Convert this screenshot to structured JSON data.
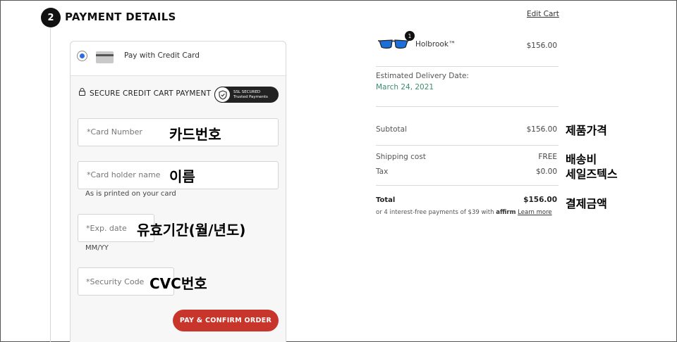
{
  "step": {
    "number": "2",
    "title": "PAYMENT DETAILS"
  },
  "payment": {
    "method_label": "Pay with Credit Card",
    "secure_label": "SECURE CREDIT CART PAYMENT",
    "ssl_line1": "SSL SECURED",
    "ssl_line2": "Trusted Payments",
    "card_number_placeholder": "*Card Number",
    "card_number_annotation": "카드번호",
    "holder_placeholder": "*Card holder name",
    "holder_annotation": "이름",
    "holder_hint": "As is printed on your card",
    "exp_placeholder": "*Exp. date",
    "exp_annotation": "유효기간(월/년도)",
    "exp_hint": "MM/YY",
    "cvc_placeholder": "*Security Code",
    "cvc_annotation": "CVC번호",
    "pay_button": "PAY & CONFIRM ORDER"
  },
  "summary": {
    "edit_cart": "Edit Cart",
    "product": {
      "name": "Holbrook™",
      "qty": "1",
      "price": "$156.00"
    },
    "delivery_label": "Estimated Delivery Date:",
    "delivery_date": "March 24, 2021",
    "subtotal_label": "Subtotal",
    "subtotal_value": "$156.00",
    "subtotal_annotation": "제품가격",
    "shipping_label": "Shipping cost",
    "shipping_value": "FREE",
    "shipping_annotation": "배송비",
    "tax_label": "Tax",
    "tax_value": "$0.00",
    "tax_annotation": "세일즈텍스",
    "total_label": "Total",
    "total_value": "$156.00",
    "total_annotation": "결제금액",
    "installment_text": "or 4 interest-free payments of $39 with",
    "affirm_logo": "affirm",
    "learn_more": "Learn more"
  },
  "colors": {
    "accent_button": "#c8352b",
    "radio_selected": "#2d6be0",
    "delivery_date": "#3a8f6d"
  }
}
